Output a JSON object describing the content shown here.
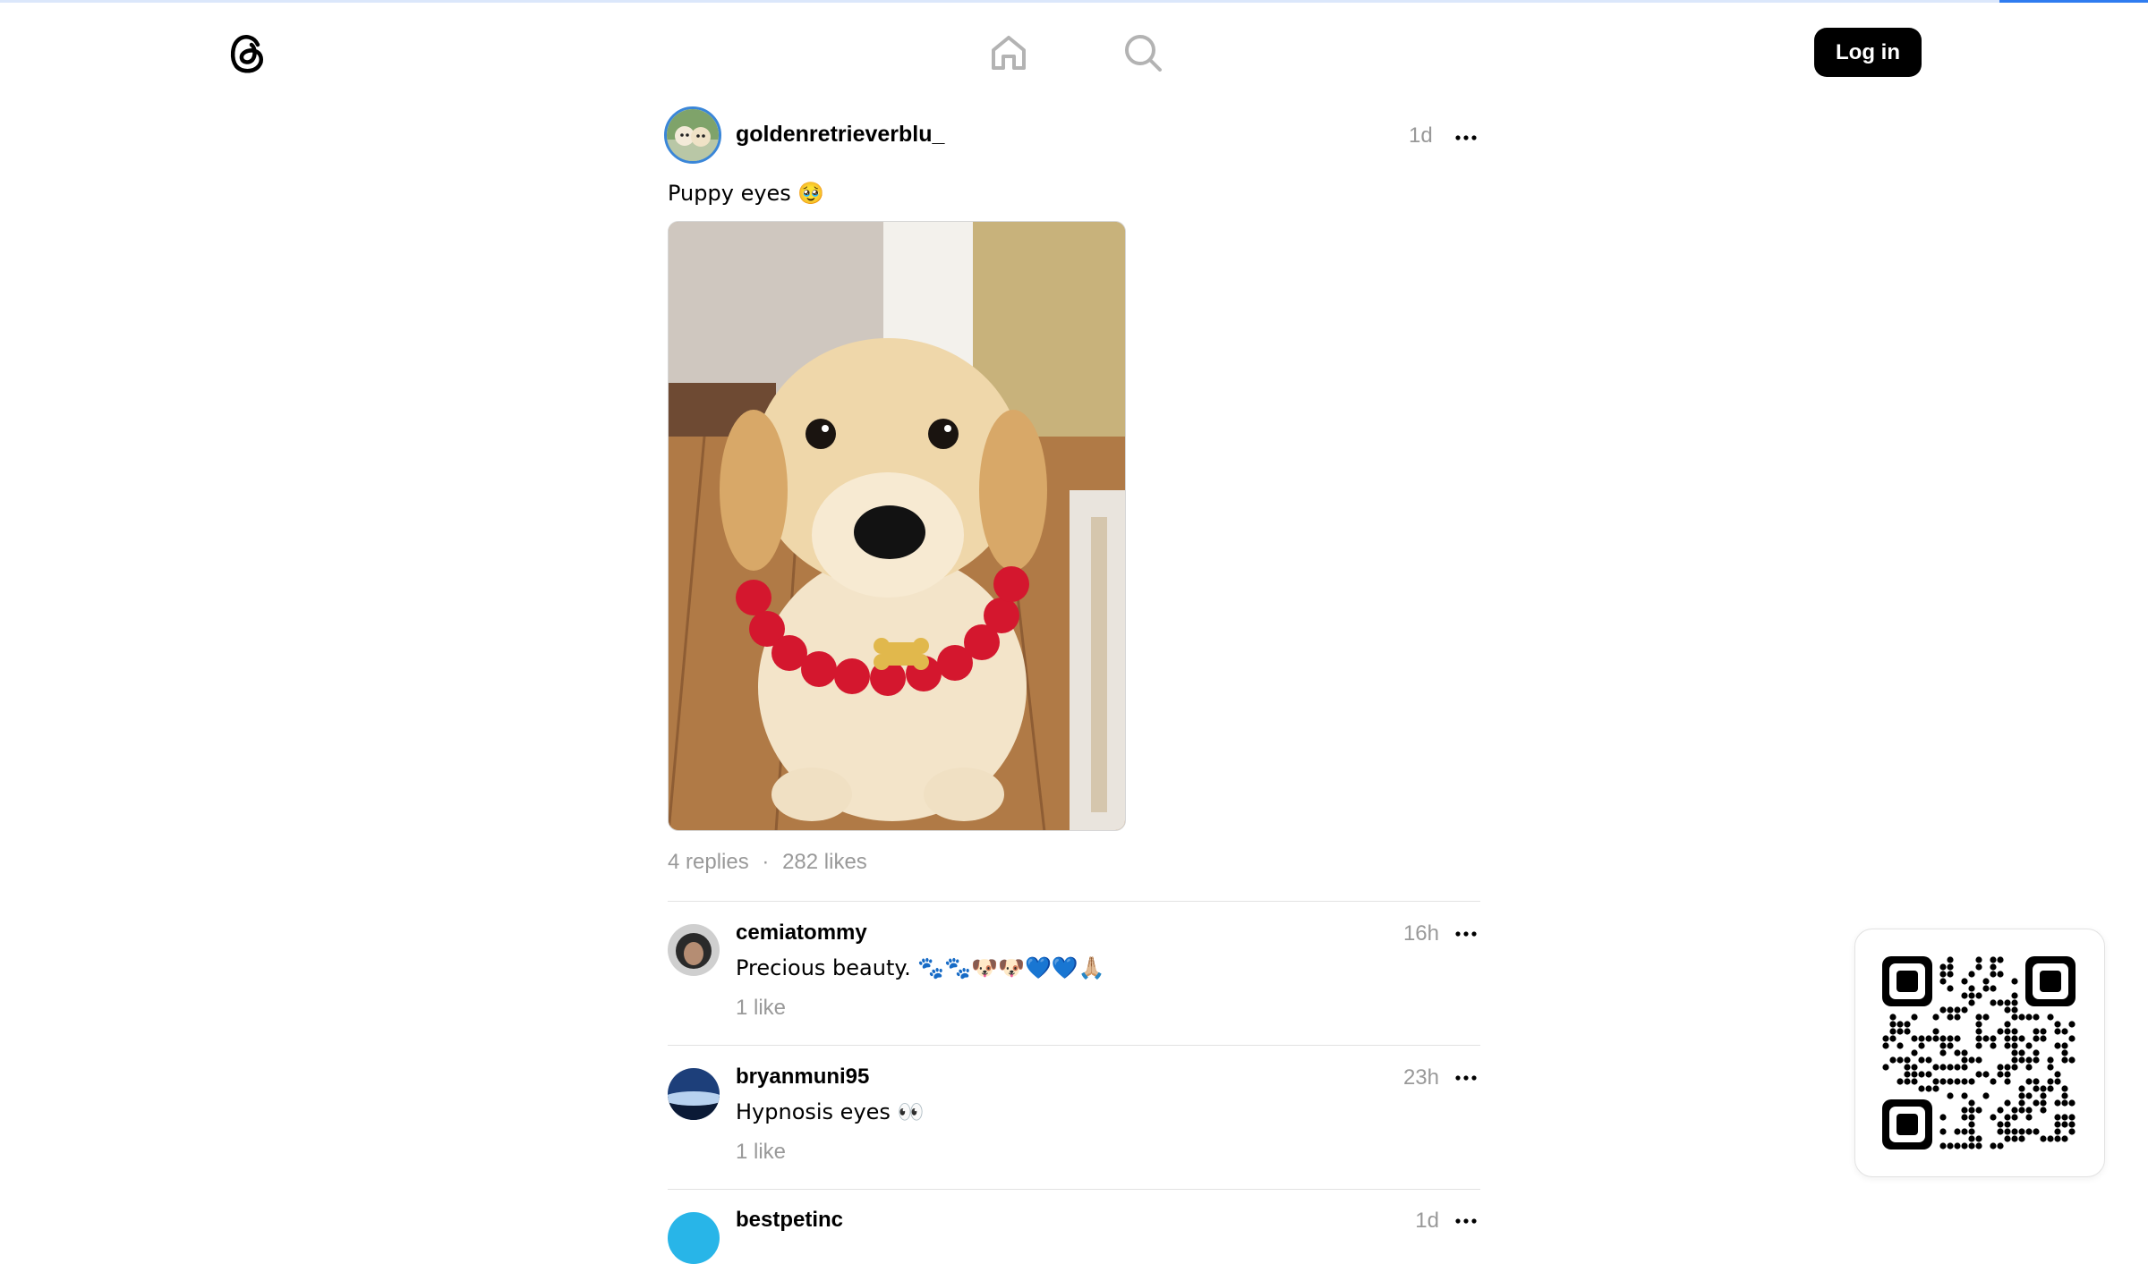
{
  "header": {
    "login_label": "Log in",
    "progress_fraction": 0.069
  },
  "post": {
    "username": "goldenretrieverblu_",
    "time": "1d",
    "text": "Puppy eyes 🥹",
    "replies": "4 replies",
    "separator": "·",
    "likes": "282 likes"
  },
  "replies": [
    {
      "username": "cemiatommy",
      "time": "16h",
      "text": "Precious beauty. 🐾🐾🐶🐶💙💙🙏🏼",
      "likes": "1 like"
    },
    {
      "username": "bryanmuni95",
      "time": "23h",
      "text": "Hypnosis eyes 👀",
      "likes": "1 like"
    },
    {
      "username": "bestpetinc",
      "time": "1d"
    }
  ],
  "colors": {
    "accent": "#2f7cf0",
    "muted": "#999999",
    "button": "#000000"
  },
  "icons": [
    "threads-logo-icon",
    "home-icon",
    "search-icon",
    "more-icon",
    "qr-code-icon"
  ]
}
